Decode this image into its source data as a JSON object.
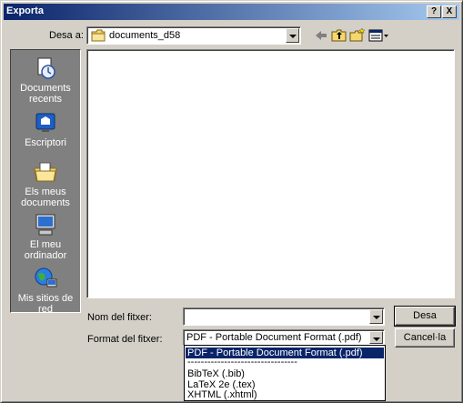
{
  "window": {
    "title": "Exporta",
    "help_label": "?",
    "close_label": "X"
  },
  "location": {
    "label": "Desa a:",
    "folder": "documents_d58"
  },
  "toolbar": {
    "back_icon": "back-arrow-icon",
    "up_icon": "up-folder-icon",
    "new_folder_icon": "new-folder-icon",
    "view_icon": "view-menu-icon"
  },
  "places": [
    {
      "label": "Documents recents",
      "icon": "recent-documents-icon"
    },
    {
      "label": "Escriptori",
      "icon": "desktop-icon"
    },
    {
      "label": "Els meus documents",
      "icon": "my-documents-icon"
    },
    {
      "label": "El meu ordinador",
      "icon": "my-computer-icon"
    },
    {
      "label": "Mis sitios de red",
      "icon": "network-places-icon"
    }
  ],
  "filename": {
    "label": "Nom del fitxer:",
    "value": ""
  },
  "format": {
    "label": "Format del fitxer:",
    "selected": "PDF - Portable Document Format (.pdf)",
    "options": [
      "PDF - Portable Document Format (.pdf)",
      "---------------------------------",
      "BibTeX (.bib)",
      "LaTeX 2e (.tex)",
      "XHTML (.xhtml)"
    ]
  },
  "buttons": {
    "save": "Desa",
    "cancel": "Cancel·la"
  }
}
